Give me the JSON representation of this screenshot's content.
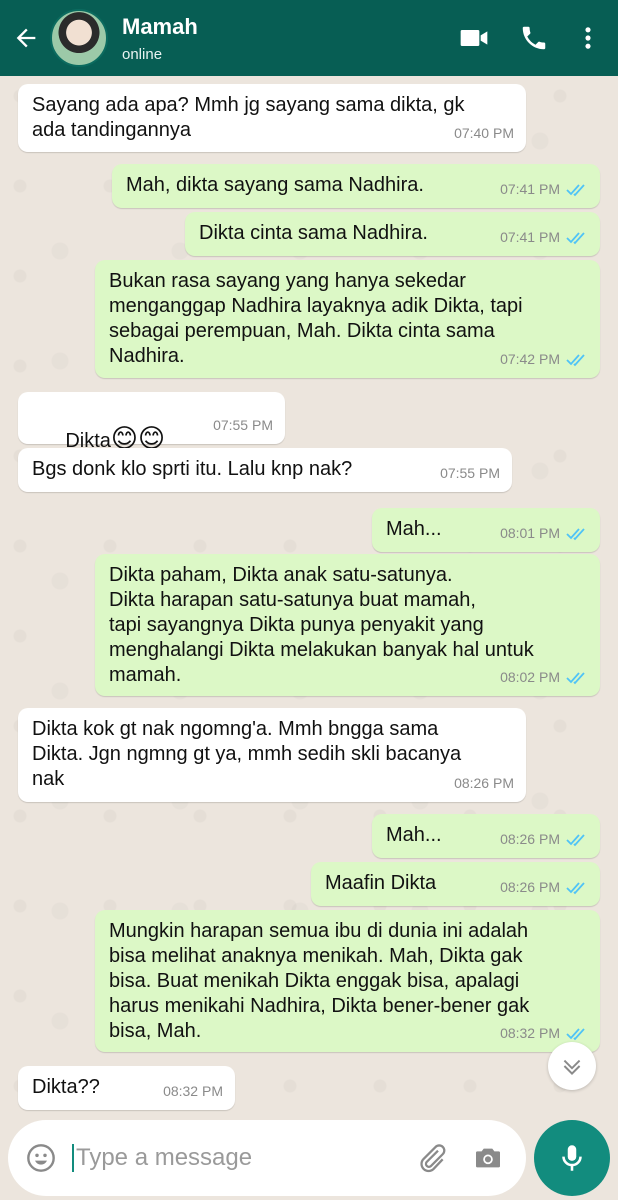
{
  "header": {
    "contact_name": "Mamah",
    "status": "online"
  },
  "messages": [
    {
      "dir": "in",
      "text": "Sayang ada apa? Mmh jg sayang sama dikta, gk\nada tandingannya",
      "time": "07:40 PM"
    },
    {
      "dir": "out",
      "text": "Mah, dikta sayang sama Nadhira.",
      "time": "07:41 PM",
      "status": "read"
    },
    {
      "dir": "out",
      "text": "Dikta cinta sama Nadhira.",
      "time": "07:41 PM",
      "status": "read"
    },
    {
      "dir": "out",
      "text": "Bukan rasa sayang yang hanya sekedar\nmenganggap Nadhira layaknya adik Dikta, tapi\nsebagai perempuan, Mah. Dikta cinta sama\nNadhira.",
      "time": "07:42 PM",
      "status": "read"
    },
    {
      "dir": "in",
      "text": "Dikta",
      "emoji": "😊😊",
      "time": "07:55 PM"
    },
    {
      "dir": "in",
      "text": "Bgs donk klo sprti itu. Lalu knp nak?",
      "time": "07:55 PM"
    },
    {
      "dir": "out",
      "text": "Mah...",
      "time": "08:01 PM",
      "status": "read"
    },
    {
      "dir": "out",
      "text": "Dikta paham, Dikta anak satu-satunya.\nDikta harapan satu-satunya buat mamah,\ntapi sayangnya Dikta punya penyakit yang\nmenghalangi Dikta melakukan banyak hal untuk\nmamah.",
      "time": "08:02 PM",
      "status": "read"
    },
    {
      "dir": "in",
      "text": "Dikta kok gt nak ngomng'a. Mmh bngga sama\nDikta. Jgn ngmng gt ya, mmh sedih skli bacanya\nnak",
      "time": "08:26 PM"
    },
    {
      "dir": "out",
      "text": "Mah...",
      "time": "08:26 PM",
      "status": "read"
    },
    {
      "dir": "out",
      "text": "Maafin Dikta",
      "time": "08:26 PM",
      "status": "read"
    },
    {
      "dir": "out",
      "text": "Mungkin harapan semua ibu di dunia ini adalah\nbisa melihat anaknya menikah. Mah, Dikta gak\nbisa. Buat menikah Dikta enggak bisa, apalagi\nharus menikahi Nadhira, Dikta bener-bener gak\nbisa, Mah.",
      "time": "08:32 PM",
      "status": "read"
    },
    {
      "dir": "in",
      "text": "Dikta??",
      "time": "08:32 PM"
    }
  ],
  "composer": {
    "placeholder": "Type a message"
  },
  "icons": {
    "back": "back-arrow-icon",
    "video": "video-call-icon",
    "call": "phone-icon",
    "menu": "more-vert-icon",
    "emoji": "emoji-icon",
    "attach": "paperclip-icon",
    "camera": "camera-icon",
    "mic": "mic-icon",
    "scroll": "chevron-down-icon"
  },
  "colors": {
    "header": "#075E54",
    "outgoing_bubble": "#DCF8C6",
    "incoming_bubble": "#FFFFFF",
    "read_tick": "#4FC3F7",
    "accent": "#128C7E"
  }
}
